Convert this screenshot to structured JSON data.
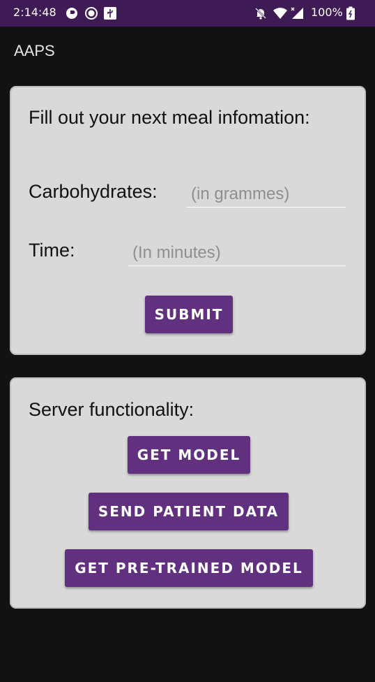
{
  "status_bar": {
    "time": "2:14:48",
    "icons": [
      "notification-circle-icon",
      "radio-icon",
      "usb-icon",
      "bell-off-icon",
      "wifi-icon",
      "signal-icon",
      "battery-icon"
    ],
    "battery_text": "100%"
  },
  "app_bar": {
    "title": "AAPS"
  },
  "meal_card": {
    "heading": "Fill out your next meal infomation:",
    "carbs_label": "Carbohydrates:",
    "carbs_placeholder": "(in grammes)",
    "time_label": "Time:",
    "time_placeholder": "(In minutes)",
    "submit_label": "SUBMIT"
  },
  "server_card": {
    "heading": "Server functionality:",
    "get_model_label": "GET MODEL",
    "send_data_label": "SEND PATIENT DATA",
    "get_pretrained_label": "GET PRE-TRAINED MODEL"
  },
  "colors": {
    "status_bar": "#3f1b56",
    "accent": "#61307e",
    "card": "#d9d9d9",
    "background": "#121212"
  }
}
